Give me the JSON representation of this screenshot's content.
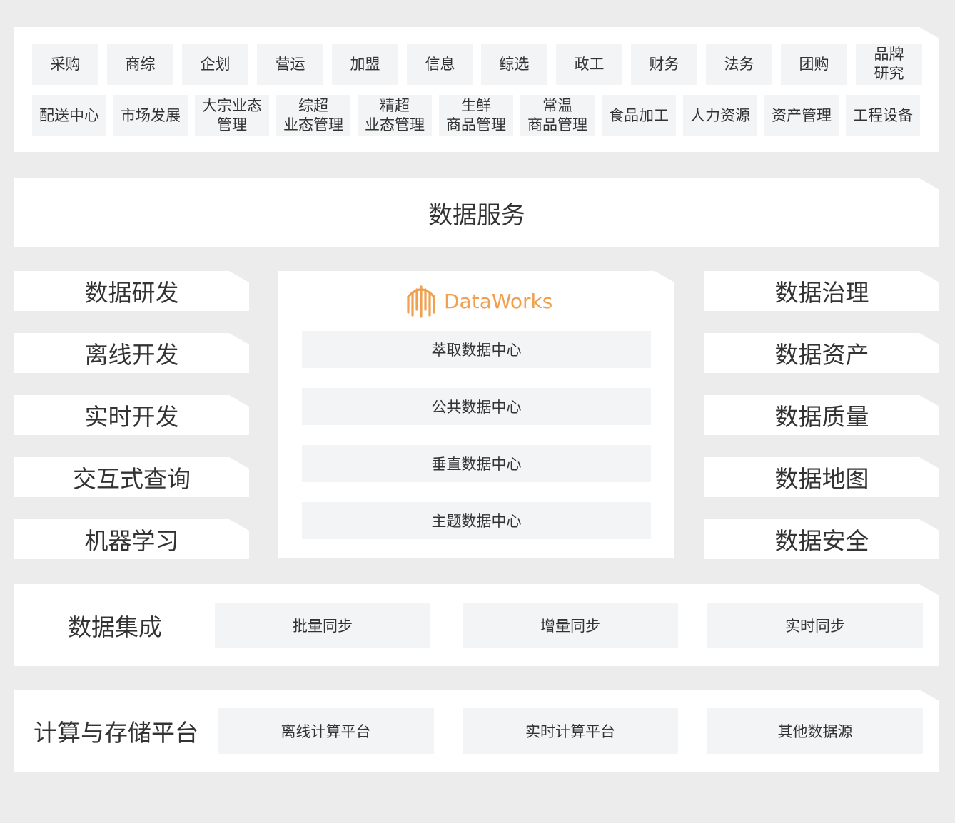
{
  "business": {
    "row1": [
      "采购",
      "商综",
      "企划",
      "营运",
      "加盟",
      "信息",
      "鲸选",
      "政工",
      "财务",
      "法务",
      "团购",
      "品牌\n研究"
    ],
    "row2": [
      "配送中心",
      "市场发展",
      "大宗业态\n管理",
      "综超\n业态管理",
      "精超\n业态管理",
      "生鲜\n商品管理",
      "常温\n商品管理",
      "食品加工",
      "人力资源",
      "资产管理",
      "工程设备"
    ]
  },
  "data_service": "数据服务",
  "left_column": [
    "数据研发",
    "离线开发",
    "实时开发",
    "交互式查询",
    "机器学习"
  ],
  "right_column": [
    "数据治理",
    "数据资产",
    "数据质量",
    "数据地图",
    "数据安全"
  ],
  "center": {
    "brand": "DataWorks",
    "brand_color": "#f0a04e",
    "hubs": [
      "萃取数据中心",
      "公共数据中心",
      "垂直数据中心",
      "主题数据中心"
    ]
  },
  "integration": {
    "label": "数据集成",
    "items": [
      "批量同步",
      "增量同步",
      "实时同步"
    ]
  },
  "compute": {
    "label": "计算与存储平台",
    "items": [
      "离线计算平台",
      "实时计算平台",
      "其他数据源"
    ]
  }
}
